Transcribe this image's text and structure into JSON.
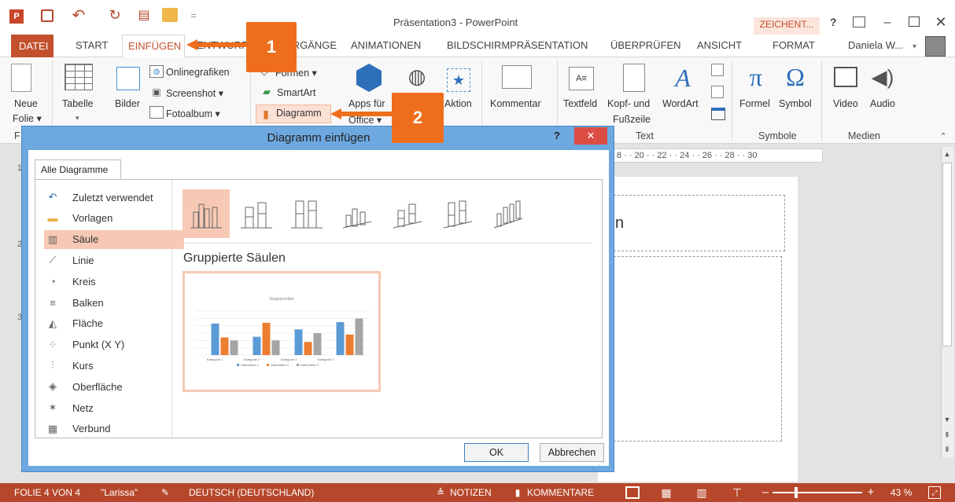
{
  "window": {
    "title": "Präsentation3 - PowerPoint",
    "context_tab": "ZEICHENT...",
    "help": "?",
    "user": "Daniela W...",
    "user_dropdown": "▾"
  },
  "tabs": [
    {
      "label": "DATEI"
    },
    {
      "label": "START"
    },
    {
      "label": "EINFÜGEN"
    },
    {
      "label": "ENTWURF"
    },
    {
      "label": "ÜBERGÄNGE"
    },
    {
      "label": "ANIMATIONEN"
    },
    {
      "label": "BILDSCHIRMPRÄSENTATION"
    },
    {
      "label": "ÜBERPRÜFEN"
    },
    {
      "label": "ANSICHT"
    },
    {
      "label": "FORMAT"
    }
  ],
  "ribbon": {
    "neue_folie": "Neue",
    "neue_folie2": "Folie ▾",
    "tabelle": "Tabelle",
    "bilder": "Bilder",
    "onlinegrafiken": "Onlinegrafiken",
    "screenshot": "Screenshot ▾",
    "fotoalbum": "Fotoalbum ▾",
    "formen": "Formen ▾",
    "smartart": "SmartArt",
    "diagramm": "Diagramm",
    "apps": "Apps für",
    "apps2": "Office ▾",
    "aktion": "Aktion",
    "kommentar": "Kommentar",
    "textfeld": "Textfeld",
    "kopfzeile": "Kopf- und",
    "kopfzeile2": "Fußzeile",
    "wordart": "WordArt",
    "formel": "Formel",
    "symbol": "Symbol",
    "video": "Video",
    "audio": "Audio",
    "group_text": "Text",
    "group_symbole": "Symbole",
    "group_medien": "Medien",
    "group_f": "F"
  },
  "ruler": {
    "ticks": "8 · · 20 · · 22 · · 24 · · 26 · · 28 · · 30"
  },
  "slide": {
    "title_fragment": "n"
  },
  "slide_numbers": {
    "n1": "1",
    "n2": "2",
    "n3": "3"
  },
  "dialog": {
    "title": "Diagramm einfügen",
    "help": "?",
    "close": "✕",
    "tab": "Alle Diagramme",
    "categories": [
      {
        "label": "Zuletzt verwendet",
        "icon": "↶"
      },
      {
        "label": "Vorlagen",
        "icon": "▬"
      },
      {
        "label": "Säule",
        "icon": "▥"
      },
      {
        "label": "Linie",
        "icon": "⟋"
      },
      {
        "label": "Kreis",
        "icon": "◔"
      },
      {
        "label": "Balken",
        "icon": "≡"
      },
      {
        "label": "Fläche",
        "icon": "◭"
      },
      {
        "label": "Punkt (X Y)",
        "icon": "⁘"
      },
      {
        "label": "Kurs",
        "icon": "⫶"
      },
      {
        "label": "Oberfläche",
        "icon": "◈"
      },
      {
        "label": "Netz",
        "icon": "✶"
      },
      {
        "label": "Verbund",
        "icon": "▦"
      }
    ],
    "selected_index": 2,
    "subtype_title": "Gruppierte Säulen",
    "ok": "OK",
    "cancel": "Abbrechen"
  },
  "preview": {
    "title": "Diagrammtitel",
    "cat1": "Kategorie 1",
    "cat2": "Kategorie 2",
    "cat3": "Kategorie 3",
    "cat4": "Kategorie 4",
    "leg1": "Datenreihe 1",
    "leg2": "Datenreihe 2",
    "leg3": "Datenreihe 3"
  },
  "chart_data": {
    "type": "bar",
    "categories": [
      "Kategorie 1",
      "Kategorie 2",
      "Kategorie 3",
      "Kategorie 4"
    ],
    "series": [
      {
        "name": "Datenreihe 1",
        "values": [
          4.3,
          2.5,
          3.5,
          4.5
        ],
        "color": "#5b9bd5"
      },
      {
        "name": "Datenreihe 2",
        "values": [
          2.4,
          4.4,
          1.8,
          2.8
        ],
        "color": "#ed7d31"
      },
      {
        "name": "Datenreihe 3",
        "values": [
          2,
          2,
          3,
          5
        ],
        "color": "#a5a5a5"
      }
    ],
    "title": "Diagrammtitel",
    "ylim": [
      0,
      6
    ]
  },
  "callouts": {
    "c1": "1",
    "c2": "2"
  },
  "status": {
    "folie": "FOLIE 4 VON 4",
    "design": "\"Larissa\"",
    "sprache": "DEUTSCH (DEUTSCHLAND)",
    "notizen": "NOTIZEN",
    "kommentare": "KOMMENTARE",
    "zoom": "43 %"
  },
  "colors": {
    "accent": "#b7472a",
    "callout": "#ee6e1c",
    "selection": "#f7c9b4"
  }
}
